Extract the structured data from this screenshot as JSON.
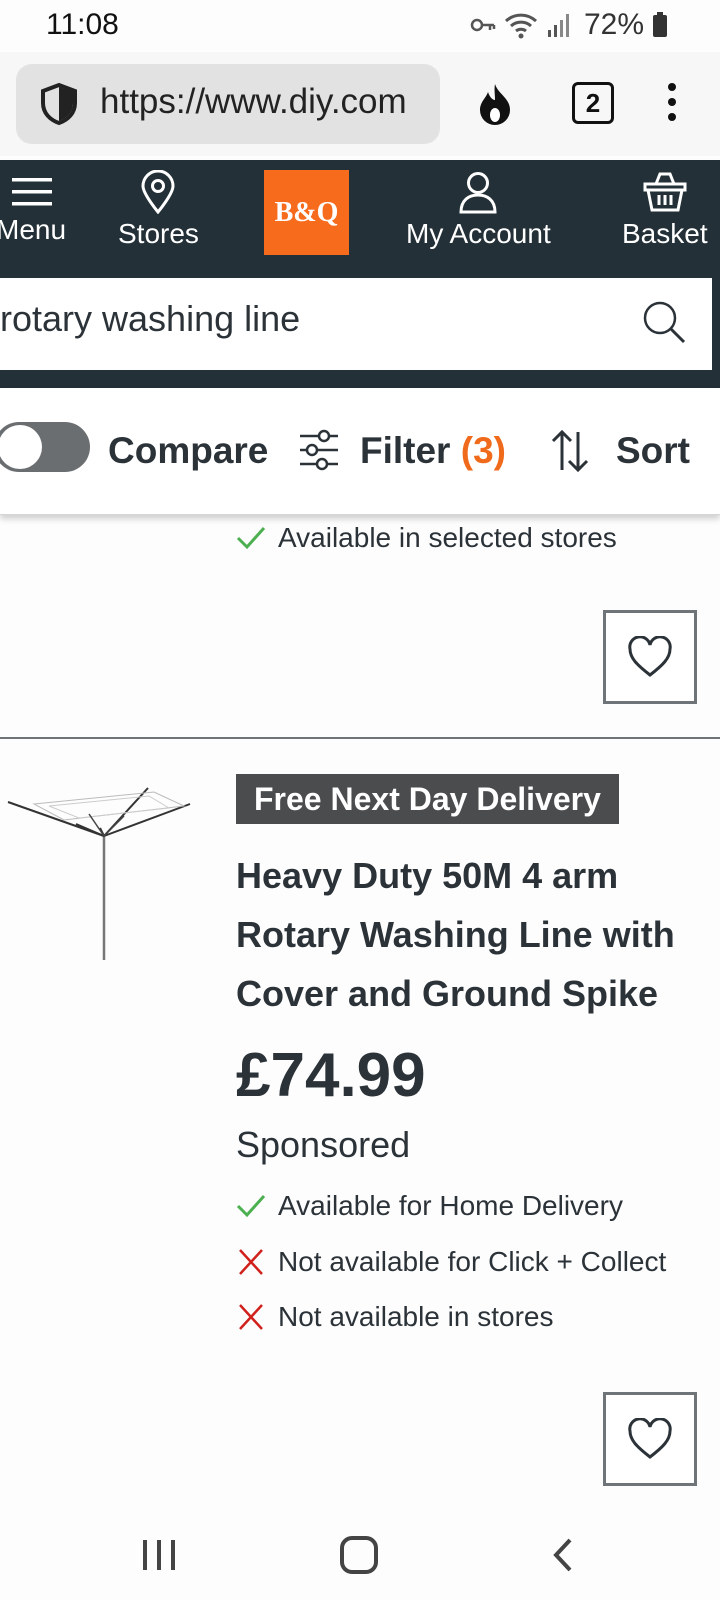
{
  "status_bar": {
    "time": "11:08",
    "battery": "72%"
  },
  "browser": {
    "url": "https://www.diy.com",
    "tab_count": "2"
  },
  "header": {
    "nav": {
      "menu": "Menu",
      "stores": "Stores",
      "account": "My Account",
      "basket": "Basket"
    },
    "logo": "B&Q",
    "search_value": "rotary washing line"
  },
  "toolbar": {
    "compare": "Compare",
    "filter": "Filter",
    "filter_count": "(3)",
    "sort": "Sort"
  },
  "listing": {
    "previous_item": {
      "availability": "Available in selected stores"
    },
    "product": {
      "badge": "Free Next Day Delivery",
      "title": "Heavy Duty 50M 4 arm Rotary Washing Line with Cover and Ground Spike",
      "price": "£74.99",
      "sponsored": "Sponsored",
      "availability": [
        {
          "text": "Available for Home Delivery",
          "status": "available"
        },
        {
          "text": "Not available for Click + Collect",
          "status": "unavailable"
        },
        {
          "text": "Not available in stores",
          "status": "unavailable"
        }
      ]
    }
  },
  "colors": {
    "header_bg": "#233037",
    "brand_orange": "#f76b1c",
    "check_green": "#4caf50",
    "cross_red": "#d0211c"
  }
}
